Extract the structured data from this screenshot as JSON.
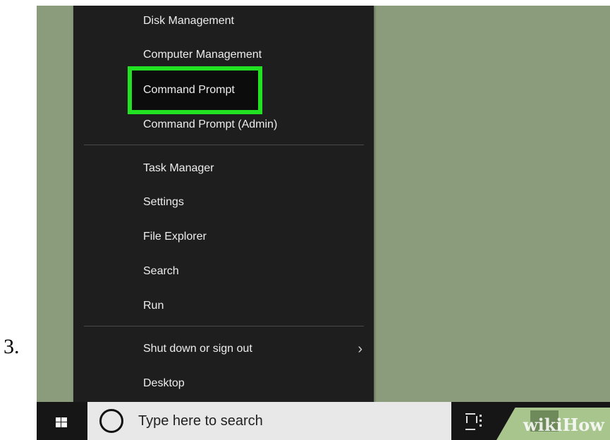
{
  "step": {
    "number": "3."
  },
  "context_menu": {
    "items": [
      {
        "label": "Disk Management"
      },
      {
        "label": "Computer Management"
      },
      {
        "label": "Command Prompt",
        "highlighted": true
      },
      {
        "label": "Command Prompt (Admin)"
      },
      {
        "label": "Task Manager"
      },
      {
        "label": "Settings"
      },
      {
        "label": "File Explorer"
      },
      {
        "label": "Search"
      },
      {
        "label": "Run"
      },
      {
        "label": "Shut down or sign out",
        "has_submenu": true
      },
      {
        "label": "Desktop"
      }
    ],
    "submenu_glyph": "›",
    "highlight_color": "#22e022"
  },
  "taskbar": {
    "search": {
      "placeholder": "Type here to search"
    },
    "start_icon": "windows-logo-icon",
    "task_view_icon": "task-view-icon"
  },
  "watermark": {
    "text": "wikiHow"
  },
  "colors": {
    "desktop": "#8a9c7c",
    "menu_background": "#1e1e1e",
    "taskbar": "#161616",
    "search_box": "#e8e8e8"
  }
}
